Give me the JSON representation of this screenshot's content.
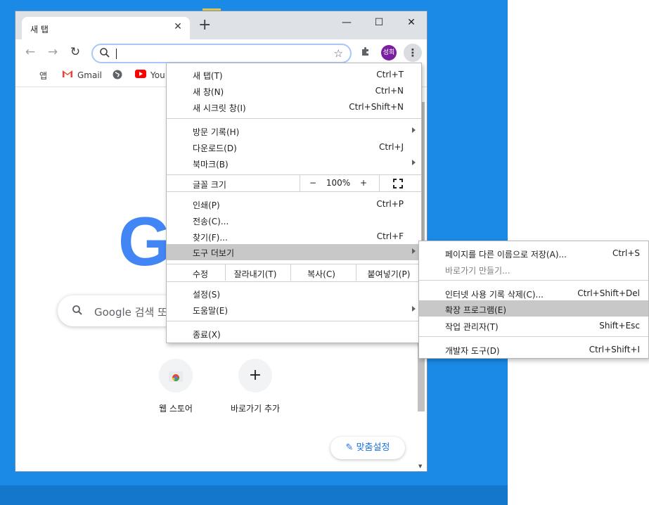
{
  "tab": {
    "title": "새 탭"
  },
  "omnibox": {
    "value": ""
  },
  "avatar": {
    "initials": "성희"
  },
  "bookmarks": [
    {
      "label": "앱",
      "icon": "apps-grid-icon"
    },
    {
      "label": "Gmail",
      "icon": "gmail-icon"
    },
    {
      "label": "",
      "icon": "globe-icon"
    },
    {
      "label": "You",
      "icon": "youtube-icon"
    }
  ],
  "ntp": {
    "logo_letter": "G",
    "search_placeholder": "Google 검색 또",
    "shortcuts": [
      {
        "label": "웹 스토어",
        "icon": "web-store-icon"
      },
      {
        "label": "바로가기 추가",
        "icon": "plus-icon"
      }
    ],
    "customize_label": "맞춤설정"
  },
  "menu": {
    "new_tab": {
      "label": "새 탭(T)",
      "shortcut": "Ctrl+T"
    },
    "new_window": {
      "label": "새 창(N)",
      "shortcut": "Ctrl+N"
    },
    "new_incognito": {
      "label": "새 시크릿 창(I)",
      "shortcut": "Ctrl+Shift+N"
    },
    "history": {
      "label": "방문 기록(H)"
    },
    "downloads": {
      "label": "다운로드(D)",
      "shortcut": "Ctrl+J"
    },
    "bookmarks": {
      "label": "북마크(B)"
    },
    "zoom": {
      "label": "글꼴 크기",
      "minus": "−",
      "value": "100%",
      "plus": "+"
    },
    "print": {
      "label": "인쇄(P)",
      "shortcut": "Ctrl+P"
    },
    "cast": {
      "label": "전송(C)..."
    },
    "find": {
      "label": "찾기(F)...",
      "shortcut": "Ctrl+F"
    },
    "more_tools": {
      "label": "도구 더보기"
    },
    "edit": {
      "label": "수정",
      "cut": "잘라내기(T)",
      "copy": "복사(C)",
      "paste": "붙여넣기(P)"
    },
    "settings": {
      "label": "설정(S)"
    },
    "help": {
      "label": "도움말(E)"
    },
    "exit": {
      "label": "종료(X)"
    }
  },
  "submenu": {
    "save_page": {
      "label": "페이지를 다른 이름으로 저장(A)...",
      "shortcut": "Ctrl+S"
    },
    "create_shortcut": {
      "label": "바로가기 만들기..."
    },
    "clear_data": {
      "label": "인터넷 사용 기록 삭제(C)...",
      "shortcut": "Ctrl+Shift+Del"
    },
    "extensions": {
      "label": "확장 프로그램(E)"
    },
    "task_manager": {
      "label": "작업 관리자(T)",
      "shortcut": "Shift+Esc"
    },
    "dev_tools": {
      "label": "개발자 도구(D)",
      "shortcut": "Ctrl+Shift+I"
    }
  },
  "colors": {
    "desktop": "#1a8ae6",
    "google_blue": "#4285f4",
    "menu_highlight": "#c8c8c8",
    "avatar": "#7b1fa2"
  }
}
